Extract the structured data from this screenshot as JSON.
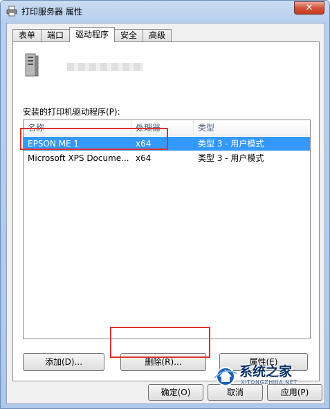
{
  "window": {
    "title": "打印服务器 属性",
    "close_label": "✕"
  },
  "tabs": [
    {
      "label": "表单"
    },
    {
      "label": "端口"
    },
    {
      "label": "驱动程序"
    },
    {
      "label": "安全"
    },
    {
      "label": "高级"
    }
  ],
  "active_tab": "驱动程序",
  "drivers": {
    "label": "安装的打印机驱动程序(P):",
    "columns": [
      "名称",
      "处理器",
      "类型"
    ],
    "rows": [
      {
        "name": "EPSON ME 1",
        "processor": "x64",
        "type": "类型 3 - 用户模式",
        "selected": true
      },
      {
        "name": "Microsoft XPS Docume...",
        "processor": "x64",
        "type": "类型 3 - 用户模式",
        "selected": false
      }
    ]
  },
  "buttons": {
    "add": "添加(D)...",
    "remove": "删除(R)...",
    "properties": "属性(E)",
    "ok": "确定(O)",
    "cancel": "取消",
    "apply": "应用(P)"
  },
  "watermark": {
    "text": "系统之家",
    "sub": "XITONGZHIJIA.NET"
  },
  "colors": {
    "selection": "#3399ff",
    "highlight_box": "#e0302e"
  }
}
